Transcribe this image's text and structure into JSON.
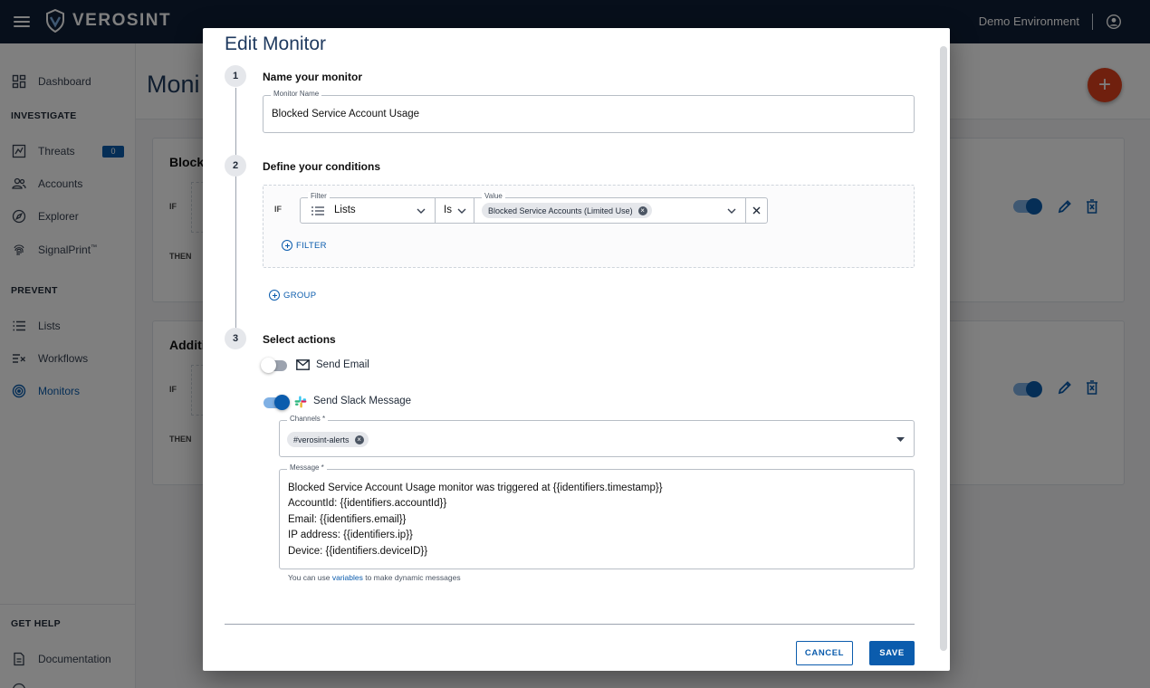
{
  "topbar": {
    "brand": "VEROSINT",
    "environment": "Demo Environment"
  },
  "sidebar": {
    "dashboard": "Dashboard",
    "investigate_header": "INVESTIGATE",
    "threats": "Threats",
    "threats_count": "0",
    "accounts": "Accounts",
    "explorer": "Explorer",
    "signalprint": "SignalPrint",
    "signalprint_tm": "™",
    "prevent_header": "PREVENT",
    "lists": "Lists",
    "workflows": "Workflows",
    "monitors": "Monitors",
    "help_header": "GET HELP",
    "documentation": "Documentation"
  },
  "page": {
    "title": "Moni",
    "cards": [
      {
        "title": "Blocke",
        "if": "IF",
        "then": "THEN"
      },
      {
        "title": "Additi",
        "if": "IF",
        "then": "THEN"
      }
    ]
  },
  "modal": {
    "title": "Edit Monitor",
    "step1": {
      "num": "1",
      "label": "Name your monitor",
      "field_label": "Monitor Name",
      "value": "Blocked Service Account Usage"
    },
    "step2": {
      "num": "2",
      "label": "Define your conditions",
      "if": "IF",
      "filter_label": "Filter",
      "filter_value": "Lists",
      "operator": "Is",
      "value_label": "Value",
      "value_chip": "Blocked Service Accounts (Limited Use)",
      "add_filter": "FILTER",
      "add_group": "GROUP"
    },
    "step3": {
      "num": "3",
      "label": "Select actions",
      "email_label": "Send Email",
      "email_enabled": false,
      "slack_label": "Send Slack Message",
      "slack_enabled": true,
      "channels_label": "Channels *",
      "channel_chip": "#verosint-alerts",
      "message_label": "Message *",
      "message": "Blocked Service Account Usage monitor was triggered at {{identifiers.timestamp}}\nAccountId: {{identifiers.accountId}}\nEmail: {{identifiers.email}}\nIP address: {{identifiers.ip}}\nDevice: {{identifiers.deviceID}}",
      "helper_prefix": "You can use ",
      "helper_link": "variables",
      "helper_suffix": " to make dynamic messages"
    },
    "cancel": "CANCEL",
    "save": "SAVE"
  },
  "colors": {
    "primary": "#0b5cad",
    "topbar": "#0f1e36",
    "fab": "#e0401d"
  }
}
